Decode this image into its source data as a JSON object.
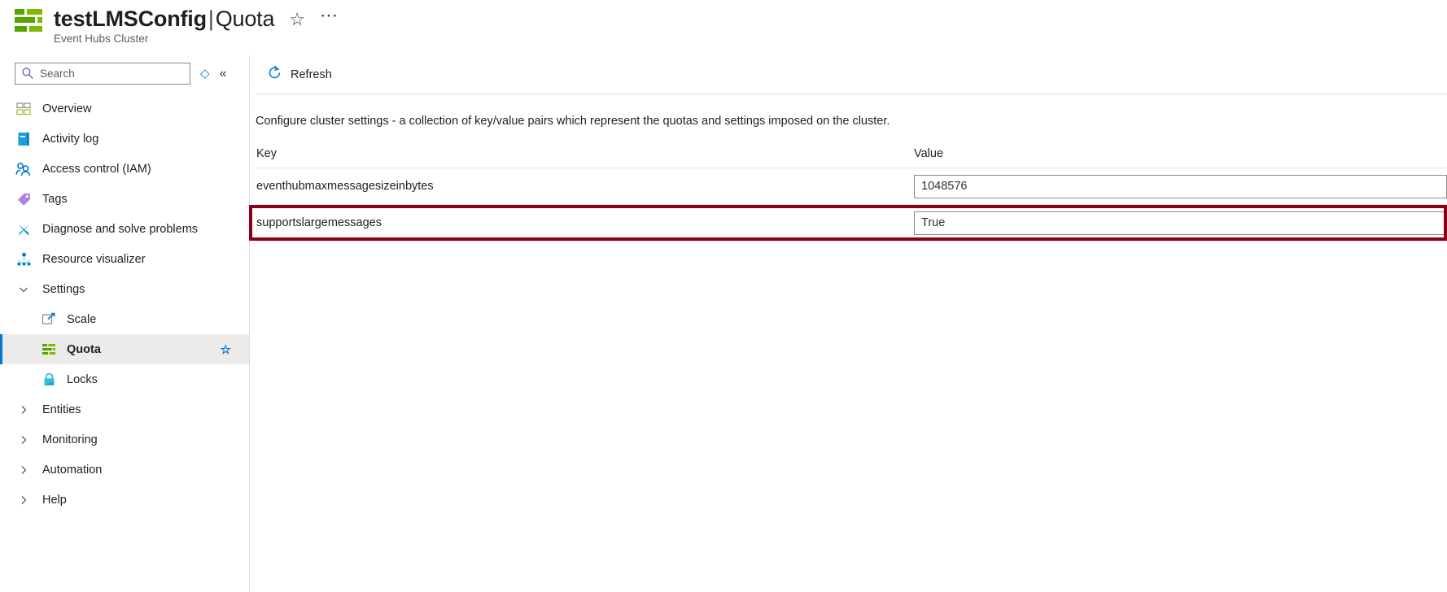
{
  "header": {
    "resource_icon": "event-hubs-cluster-icon",
    "title": "testLMSConfig",
    "separator": "|",
    "page": "Quota",
    "subtitle": "Event Hubs Cluster",
    "favorite_icon": "star-icon",
    "more_icon": "ellipsis-icon"
  },
  "sidebar": {
    "search": {
      "placeholder": "Search",
      "value": "",
      "icon": "search-icon"
    },
    "refresh_nav_icon": "diamond-icon",
    "collapse_icon": "double-chevron-left-icon",
    "items": [
      {
        "label": "Overview",
        "icon": "overview-grid-icon",
        "type": "item"
      },
      {
        "label": "Activity log",
        "icon": "activity-log-book-icon",
        "type": "item"
      },
      {
        "label": "Access control (IAM)",
        "icon": "people-icon",
        "type": "item"
      },
      {
        "label": "Tags",
        "icon": "tag-icon",
        "type": "item"
      },
      {
        "label": "Diagnose and solve problems",
        "icon": "wrench-icon",
        "type": "item"
      },
      {
        "label": "Resource visualizer",
        "icon": "resource-visualizer-icon",
        "type": "item"
      },
      {
        "label": "Settings",
        "icon": "chevron-down-icon",
        "type": "group",
        "expanded": true
      },
      {
        "label": "Scale",
        "icon": "scale-arrow-icon",
        "type": "child"
      },
      {
        "label": "Quota",
        "icon": "quota-bars-icon",
        "type": "child",
        "selected": true,
        "pin_icon": "star-icon"
      },
      {
        "label": "Locks",
        "icon": "lock-icon",
        "type": "child"
      },
      {
        "label": "Entities",
        "icon": "chevron-right-icon",
        "type": "group",
        "expanded": false
      },
      {
        "label": "Monitoring",
        "icon": "chevron-right-icon",
        "type": "group",
        "expanded": false
      },
      {
        "label": "Automation",
        "icon": "chevron-right-icon",
        "type": "group",
        "expanded": false
      },
      {
        "label": "Help",
        "icon": "chevron-right-icon",
        "type": "group",
        "expanded": false
      }
    ]
  },
  "main": {
    "toolbar": {
      "refresh_label": "Refresh",
      "refresh_icon": "refresh-icon"
    },
    "description": "Configure cluster settings - a collection of key/value pairs which represent the quotas and settings imposed on the cluster.",
    "table": {
      "headers": {
        "key": "Key",
        "value": "Value"
      },
      "rows": [
        {
          "key": "eventhubmaxmessagesizeinbytes",
          "value": "1048576",
          "highlighted": false
        },
        {
          "key": "supportslargemessages",
          "value": "True",
          "highlighted": true
        }
      ]
    }
  },
  "colors": {
    "accent": "#0078d4",
    "brand_green": "#7cbb00",
    "highlight_border": "#8b0016",
    "selected_bg": "#edebe9"
  }
}
